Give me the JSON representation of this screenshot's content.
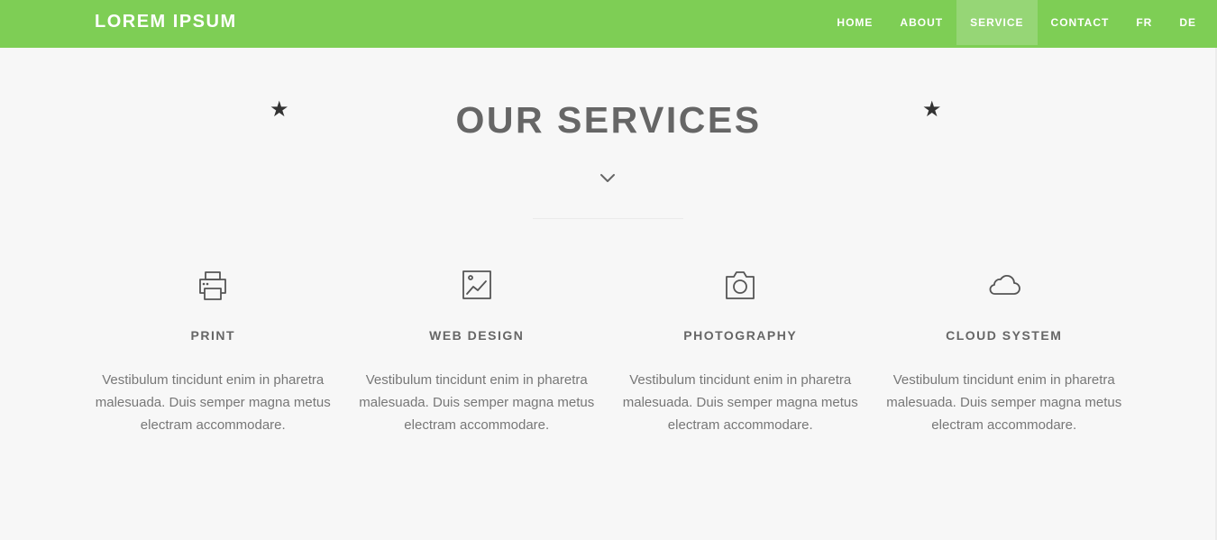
{
  "brand": "LOREM IPSUM",
  "nav": {
    "items": [
      "HOME",
      "ABOUT",
      "SERVICE",
      "CONTACT",
      "FR",
      "DE"
    ],
    "active": "SERVICE"
  },
  "section": {
    "title": "OUR SERVICES",
    "decor_icon": "star-icon",
    "scroll_icon": "chevron-down-icon"
  },
  "services": [
    {
      "icon": "printer-icon",
      "title": "PRINT",
      "text": "Vestibulum tincidunt enim in pharetra malesuada. Duis semper magna metus electram accommodare."
    },
    {
      "icon": "image-icon",
      "title": "WEB DESIGN",
      "text": "Vestibulum tincidunt enim in pharetra malesuada. Duis semper magna metus electram accommodare."
    },
    {
      "icon": "camera-icon",
      "title": "PHOTOGRAPHY",
      "text": "Vestibulum tincidunt enim in pharetra malesuada. Duis semper magna metus electram accommodare."
    },
    {
      "icon": "cloud-icon",
      "title": "CLOUD SYSTEM",
      "text": "Vestibulum tincidunt enim in pharetra malesuada. Duis semper magna metus electram accommodare."
    }
  ],
  "colors": {
    "navbar": "#7ece55",
    "nav_active": "#96d676",
    "background": "#f7f7f7",
    "heading": "#666666",
    "body_text": "#777777"
  }
}
